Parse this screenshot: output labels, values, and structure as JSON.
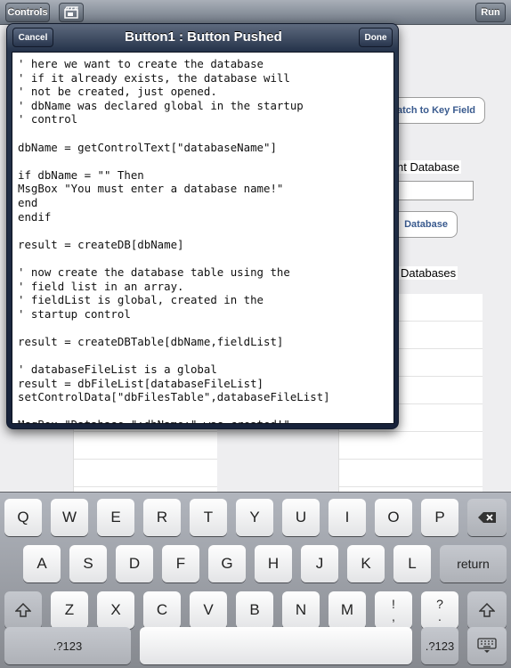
{
  "topbar": {
    "controls_label": "Controls",
    "icon": "clapperboard-icon",
    "run_label": "Run"
  },
  "background": {
    "match_button_label": "atch to Key Field",
    "current_db_label": "nt Database",
    "create_button_label": "Database",
    "databases_label": "Databases"
  },
  "modal": {
    "title": "Button1 : Button Pushed",
    "cancel_label": "Cancel",
    "done_label": "Done",
    "code": "' here we want to create the database\n' if it already exists, the database will\n' not be created, just opened.\n' dbName was declared global in the startup\n' control\n\ndbName = getControlText[\"databaseName\"]\n\nif dbName = \"\" Then\nMsgBox \"You must enter a database name!\"\nend\nendif\n\nresult = createDB[dbName]\n\n' now create the database table using the\n' field list in an array.\n' fieldList is global, created in the\n' startup control\n\nresult = createDBTable[dbName,fieldList]\n\n' databaseFileList is a global\nresult = dbFileList[databaseFileList]\nsetControlData[\"dbFilesTable\",databaseFileList]\n\nMsgBox \"Database \";dbName;\" was created!\""
  },
  "keyboard": {
    "row1": [
      "Q",
      "W",
      "E",
      "R",
      "T",
      "Y",
      "U",
      "I",
      "O",
      "P"
    ],
    "row2": [
      "A",
      "S",
      "D",
      "F",
      "G",
      "H",
      "J",
      "K",
      "L"
    ],
    "row3": [
      "Z",
      "X",
      "C",
      "V",
      "B",
      "N",
      "M"
    ],
    "backspace_icon": "backspace-icon",
    "return_label": "return",
    "shift_icon": "shift-icon",
    "punct1_top": "!",
    "punct1_bottom": ",",
    "punct2_top": "?",
    "punct2_bottom": ".",
    "numbers_label": ".?123",
    "hide_keyboard_icon": "hide-keyboard-icon"
  }
}
